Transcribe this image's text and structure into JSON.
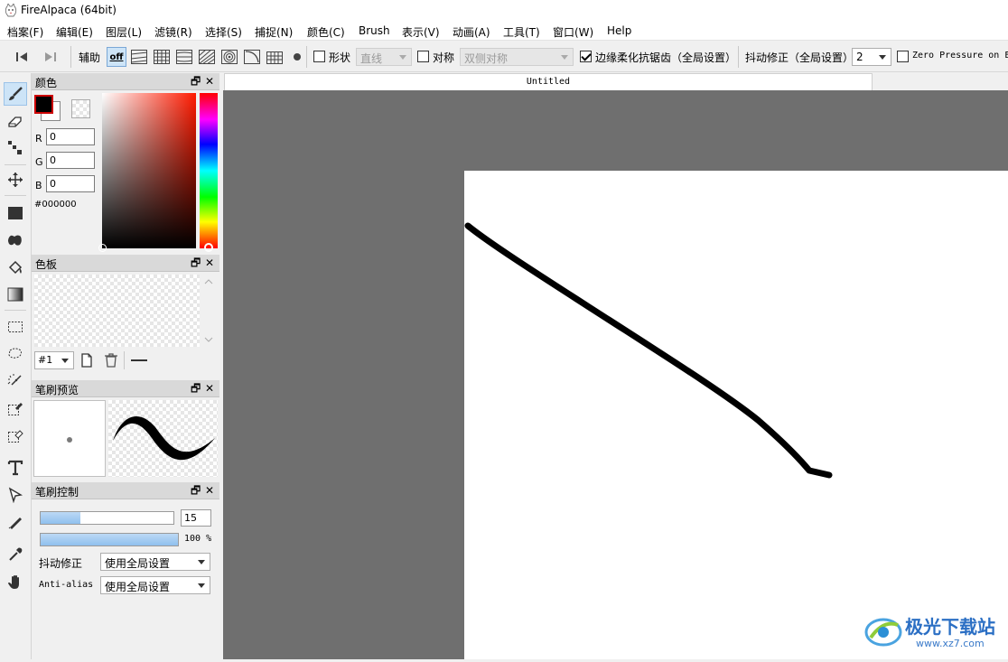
{
  "window": {
    "title": "FireAlpaca (64bit)"
  },
  "menu": [
    "档案(F)",
    "编辑(E)",
    "图层(L)",
    "滤镜(R)",
    "选择(S)",
    "捕捉(N)",
    "颜色(C)",
    "Brush",
    "表示(V)",
    "动画(A)",
    "工具(T)",
    "窗口(W)",
    "Help"
  ],
  "toolbar": {
    "assist_label": "辅助",
    "off_label": "off",
    "shape_label": "形状",
    "shape_value": "直线",
    "symmetry_label": "对称",
    "symmetry_value": "双侧对称",
    "antialias_label": "边缘柔化抗锯齿（全局设置）",
    "antialias_checked": true,
    "stabilizer_label": "抖动修正（全局设置）",
    "stabilizer_value": "2",
    "zero_pressure_label": "Zero Pressure on E"
  },
  "tools": [
    "brush-tool",
    "eraser-tool",
    "dot-tool",
    "move-tool",
    "rect-fill-tool",
    "fill-tool",
    "bucket-tool",
    "gradient-tool",
    "select-tool",
    "lasso-tool",
    "magic-wand-tool",
    "select-pen-tool",
    "select-eraser-tool",
    "text-tool",
    "operation-tool",
    "divide-tool",
    "eyedropper-tool",
    "hand-tool"
  ],
  "panels": {
    "color": {
      "title": "颜色",
      "r_label": "R",
      "r": "0",
      "g_label": "G",
      "g": "0",
      "b_label": "B",
      "b": "0",
      "hex": "#000000",
      "foreground": "#000000",
      "background": "#ffffff"
    },
    "palette": {
      "title": "色板",
      "selected": "#1"
    },
    "brush_preview": {
      "title": "笔刷预览"
    },
    "brush_control": {
      "title": "笔刷控制",
      "size": "15",
      "size_fraction": 0.3,
      "opacity": "100 %",
      "opacity_fraction": 1.0,
      "stabilizer_label": "抖动修正",
      "stabilizer_value": "使用全局设置",
      "antialias_label": "Anti-alias",
      "antialias_value": "使用全局设置"
    }
  },
  "document": {
    "tab_title": "Untitled"
  },
  "watermark": {
    "text": "极光下载站",
    "url": "www.xz7.com"
  }
}
